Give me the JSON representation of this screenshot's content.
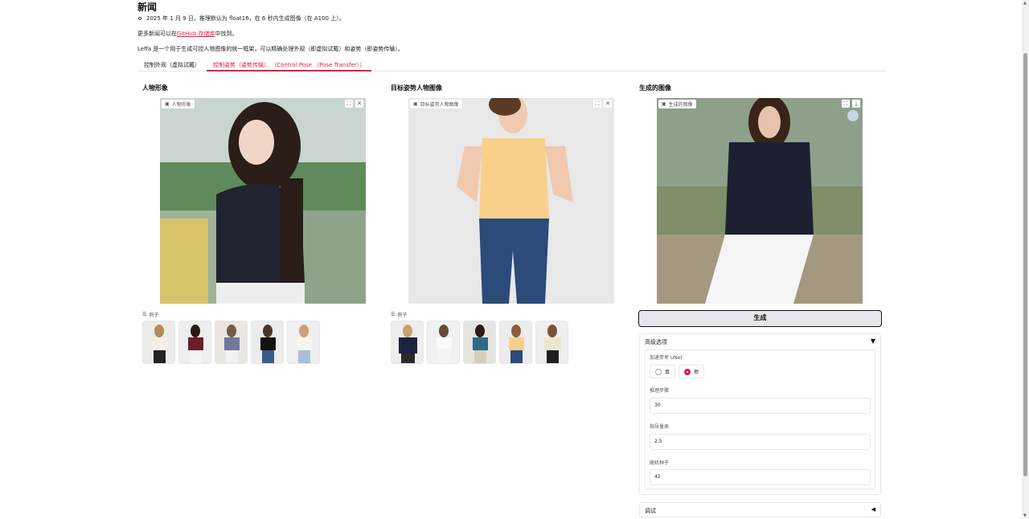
{
  "news": {
    "title": "新闻",
    "bullet": "2025 年 1 月 9 日。推理默认为 float16，在 6 秒内生成图像（在 A100 上）。",
    "more_prefix": "更多新闻可以在",
    "more_link": "GitHub 存储库",
    "more_suffix": "中找到。",
    "description": "Leffa 是一个用于生成可控人物图像的统一框架，可以精确处理外观（即虚拟试戴）和姿势（即姿势传输）。"
  },
  "tabs": [
    {
      "label": "控制外观（虚拟试戴）",
      "active": false
    },
    {
      "label": "控制姿势（姿势传输） （Control Pose （Pose Transfer））",
      "active": true
    }
  ],
  "columns": {
    "person": {
      "title": "人物形象",
      "image_label": "人物形象",
      "examples_label": "例子"
    },
    "target_pose": {
      "title": "目标姿势人物图像",
      "image_label": "目标姿势人物图像",
      "examples_label": "例子"
    },
    "generated": {
      "title": "生成的图像",
      "image_label": "生成的图像"
    }
  },
  "generate_button": "生成",
  "advanced": {
    "header": "高级选项",
    "ref_unet_label": "加速参考 UNet",
    "ref_unet_options": [
      "真",
      "假"
    ],
    "ref_unet_selected": "假",
    "steps_label": "推理步骤",
    "steps_value": "30",
    "guidance_label": "指导量表",
    "guidance_value": "2.5",
    "seed_label": "随机种子",
    "seed_value": "42"
  },
  "debug": {
    "header": "调试"
  },
  "colors": {
    "accent": "#e11d48",
    "button_bg": "#e5e7eb"
  },
  "icons": {
    "image": "image-icon",
    "fullscreen": "fullscreen-icon",
    "close": "close-icon",
    "download": "download-icon",
    "share": "share-icon",
    "list": "list-icon"
  }
}
